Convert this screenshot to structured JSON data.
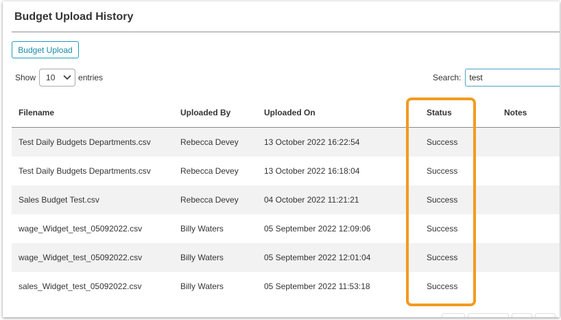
{
  "panel": {
    "title": "Budget Upload History"
  },
  "toolbar": {
    "upload_label": "Budget Upload"
  },
  "length_menu": {
    "prefix": "Show",
    "selected": "10",
    "suffix": "entries"
  },
  "search": {
    "label": "Search:",
    "value": "test"
  },
  "table": {
    "headers": {
      "filename": "Filename",
      "uploaded_by": "Uploaded By",
      "uploaded_on": "Uploaded On",
      "status": "Status",
      "notes": "Notes"
    },
    "rows": [
      {
        "filename": "Test Daily Budgets Departments.csv",
        "uploaded_by": "Rebecca Devey",
        "uploaded_on": "13 October 2022 16:22:54",
        "status": "Success",
        "notes": ""
      },
      {
        "filename": "Test Daily Budgets Departments.csv",
        "uploaded_by": "Rebecca Devey",
        "uploaded_on": "13 October 2022 16:18:04",
        "status": "Success",
        "notes": ""
      },
      {
        "filename": "Sales Budget Test.csv",
        "uploaded_by": "Rebecca Devey",
        "uploaded_on": "04 October 2022 11:21:21",
        "status": "Success",
        "notes": ""
      },
      {
        "filename": "wage_Widget_test_05092022.csv",
        "uploaded_by": "Billy Waters",
        "uploaded_on": "05 September 2022 12:09:06",
        "status": "Success",
        "notes": ""
      },
      {
        "filename": "wage_Widget_test_05092022.csv",
        "uploaded_by": "Billy Waters",
        "uploaded_on": "05 September 2022 12:01:04",
        "status": "Success",
        "notes": ""
      },
      {
        "filename": "sales_Widget_test_05092022.csv",
        "uploaded_by": "Billy Waters",
        "uploaded_on": "05 September 2022 11:53:18",
        "status": "Success",
        "notes": ""
      }
    ]
  },
  "colors": {
    "accent": "#1b9dbc",
    "highlight": "#f39a1f",
    "stripe": "#f2f2f2"
  }
}
